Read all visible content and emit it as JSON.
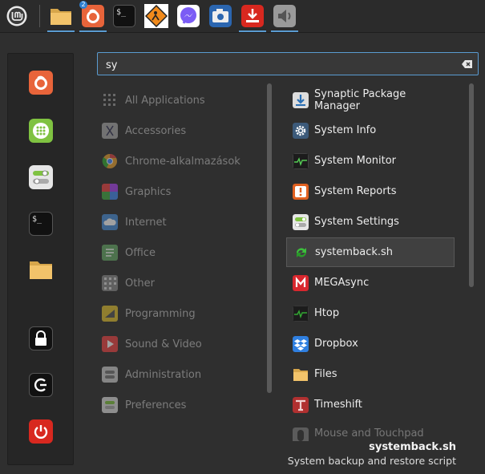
{
  "taskbar": {
    "launchers": [
      {
        "name": "mint-menu",
        "icon": "linux-mint-logo-icon"
      },
      {
        "name": "files",
        "icon": "folder-icon"
      },
      {
        "name": "firefox",
        "icon": "firefox-icon",
        "badge": "2"
      },
      {
        "name": "terminal",
        "icon": "terminal-icon"
      },
      {
        "name": "warning-app",
        "icon": "warning-sign-icon"
      },
      {
        "name": "messenger",
        "icon": "messenger-icon"
      },
      {
        "name": "screenshot",
        "icon": "camera-icon"
      },
      {
        "name": "downloader",
        "icon": "download-icon"
      },
      {
        "name": "sound",
        "icon": "speaker-icon"
      }
    ]
  },
  "search": {
    "value": "sy",
    "placeholder": ""
  },
  "favorites": [
    {
      "name": "firefox",
      "icon": "firefox-icon"
    },
    {
      "name": "software-manager",
      "icon": "grid-icon"
    },
    {
      "name": "system-settings",
      "icon": "toggle-icon"
    },
    {
      "name": "terminal",
      "icon": "terminal-icon"
    },
    {
      "name": "files",
      "icon": "folder-icon"
    },
    {
      "name": "lock-screen",
      "icon": "lock-icon"
    },
    {
      "name": "logout",
      "icon": "logout-icon"
    },
    {
      "name": "shutdown",
      "icon": "power-icon"
    }
  ],
  "categories": [
    {
      "label": "All Applications",
      "icon": "grid-icon"
    },
    {
      "label": "Accessories",
      "icon": "scissors-icon"
    },
    {
      "label": "Chrome-alkalmazások",
      "icon": "chrome-icon"
    },
    {
      "label": "Graphics",
      "icon": "palette-icon"
    },
    {
      "label": "Internet",
      "icon": "cloud-icon"
    },
    {
      "label": "Office",
      "icon": "document-icon"
    },
    {
      "label": "Other",
      "icon": "grid-icon"
    },
    {
      "label": "Programming",
      "icon": "code-icon"
    },
    {
      "label": "Sound & Video",
      "icon": "play-icon"
    },
    {
      "label": "Administration",
      "icon": "admin-icon"
    },
    {
      "label": "Preferences",
      "icon": "preferences-icon"
    }
  ],
  "apps": [
    {
      "label": "Synaptic Package Manager",
      "icon": "synaptic-icon"
    },
    {
      "label": "System Info",
      "icon": "gear-icon"
    },
    {
      "label": "System Monitor",
      "icon": "monitor-icon"
    },
    {
      "label": "System Reports",
      "icon": "report-icon"
    },
    {
      "label": "System Settings",
      "icon": "toggle-icon"
    },
    {
      "label": "systemback.sh",
      "icon": "refresh-icon"
    },
    {
      "label": "MEGAsync",
      "icon": "mega-icon"
    },
    {
      "label": "Htop",
      "icon": "htop-icon"
    },
    {
      "label": "Dropbox",
      "icon": "dropbox-icon"
    },
    {
      "label": "Files",
      "icon": "folder-icon"
    },
    {
      "label": "Timeshift",
      "icon": "timeshift-icon"
    },
    {
      "label": "Mouse and Touchpad",
      "icon": "mouse-icon"
    }
  ],
  "selected": {
    "title": "systemback.sh",
    "description": "System backup and restore script"
  },
  "colors": {
    "accent": "#5a9bd1",
    "panel": "#2b2b2b",
    "menu_bg": "#2f2f2f",
    "favorites_bg": "#262626",
    "highlight": "#404040"
  }
}
